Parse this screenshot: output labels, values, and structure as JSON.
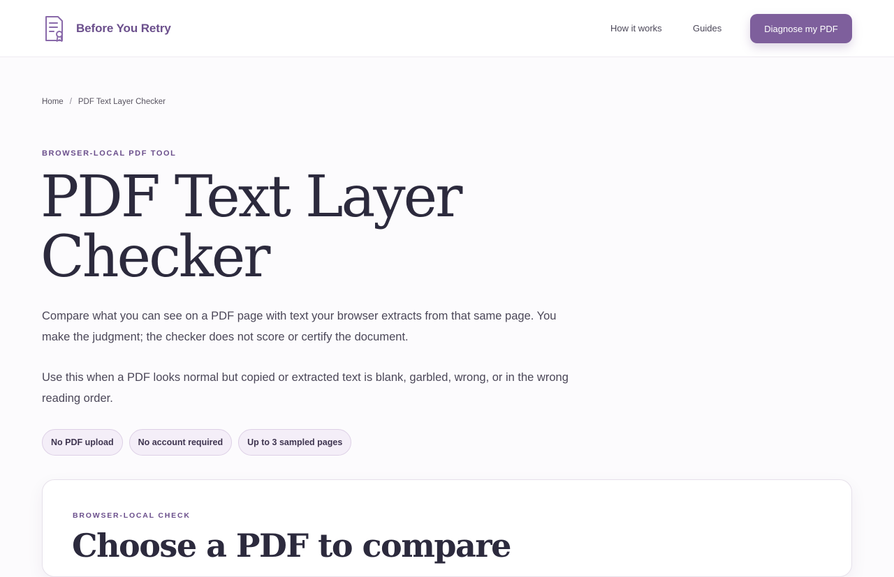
{
  "header": {
    "brand_name": "Before You Retry",
    "logo_icon": "document-certificate-icon",
    "nav": {
      "how_it_works": "How it works",
      "guides": "Guides"
    },
    "cta_label": "Diagnose my PDF"
  },
  "breadcrumb": {
    "home": "Home",
    "separator": "/",
    "current": "PDF Text Layer Checker"
  },
  "hero": {
    "eyebrow": "BROWSER-LOCAL PDF TOOL",
    "title_line1": "PDF Text Layer",
    "title_line2": "Checker",
    "lede_1": "Compare what you can see on a PDF page with text your browser extracts from that same page. You make the judgment; the checker does not score or certify the document.",
    "lede_2": "Use this when a PDF looks normal but copied or extracted text is blank, garbled, wrong, or in the wrong reading order.",
    "pills": [
      "No PDF upload",
      "No account required",
      "Up to 3 sampled pages"
    ]
  },
  "check_card": {
    "eyebrow": "BROWSER-LOCAL CHECK",
    "title": "Choose a PDF to compare"
  },
  "colors": {
    "accent": "#7e5f9c",
    "brand_text": "#6b4f8c",
    "heading": "#2c2a3d",
    "pill_bg": "#f4eef8"
  }
}
